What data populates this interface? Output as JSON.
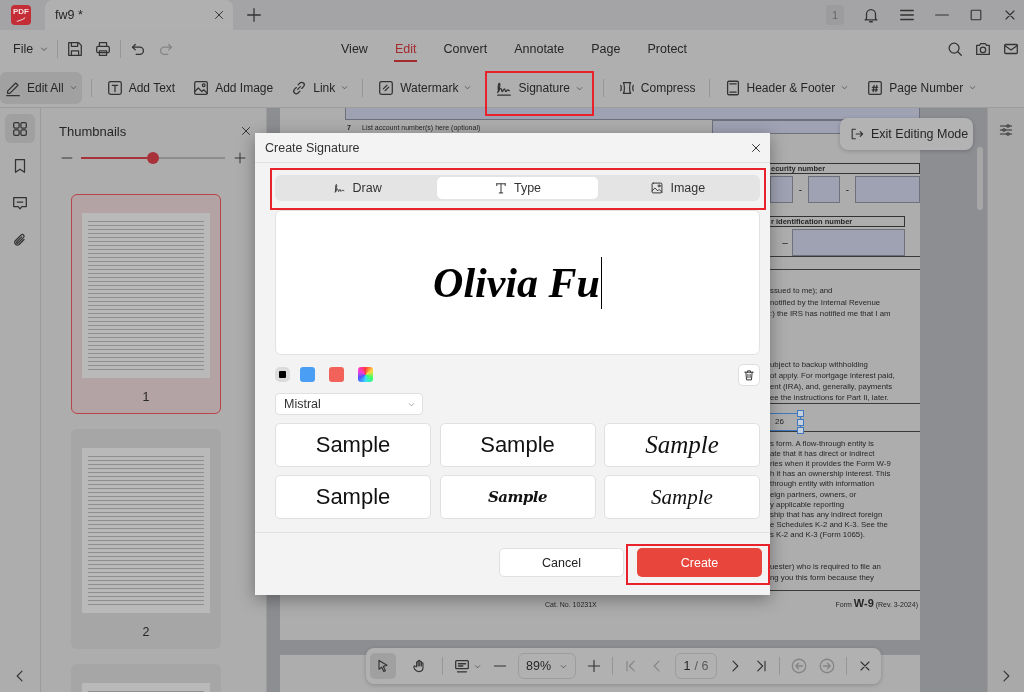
{
  "app": {
    "logo_text": "PDF"
  },
  "title_bar": {
    "tabs": [
      {
        "title": "fw9 *",
        "selected": true
      }
    ],
    "notification_count": "1"
  },
  "menu_bar": {
    "file_menu": "File",
    "quick_actions": [
      {
        "disabled": false
      },
      {
        "disabled": false
      },
      {
        "disabled": false
      },
      {
        "disabled": true
      }
    ],
    "ribbon_tabs": [
      {
        "label": "View",
        "selected": false
      },
      {
        "label": "Edit",
        "selected": true
      },
      {
        "label": "Convert",
        "selected": false
      },
      {
        "label": "Annotate",
        "selected": false
      },
      {
        "label": "Page",
        "selected": false
      },
      {
        "label": "Protect",
        "selected": false
      }
    ]
  },
  "toolbar": {
    "groups": [
      {
        "items": [
          {
            "label": "Edit All",
            "dropdown": true,
            "selected": true,
            "highlighted": false
          }
        ]
      },
      {
        "items": [
          {
            "label": "Add Text",
            "dropdown": false,
            "selected": false,
            "highlighted": false
          },
          {
            "label": "Add Image",
            "dropdown": false,
            "selected": false,
            "highlighted": false
          },
          {
            "label": "Link",
            "dropdown": true,
            "selected": false,
            "highlighted": false
          }
        ]
      },
      {
        "items": [
          {
            "label": "Watermark",
            "dropdown": true,
            "selected": false,
            "highlighted": false
          },
          {
            "label": "Signature",
            "dropdown": true,
            "selected": false,
            "highlighted": true
          }
        ]
      },
      {
        "items": [
          {
            "label": "Compress",
            "dropdown": false,
            "selected": false,
            "highlighted": false
          }
        ]
      },
      {
        "items": [
          {
            "label": "Header & Footer",
            "dropdown": true,
            "selected": false,
            "highlighted": false
          },
          {
            "label": "Page Number",
            "dropdown": true,
            "selected": false,
            "highlighted": false
          }
        ]
      }
    ]
  },
  "side_rail": {
    "items": [
      {
        "selected": true
      },
      {
        "selected": false
      },
      {
        "selected": false
      },
      {
        "selected": false
      }
    ]
  },
  "thumbnails": {
    "title": "Thumbnails",
    "zoom": {
      "level": 0.5
    },
    "pages": [
      {
        "label": "1",
        "selected": true
      },
      {
        "label": "2",
        "selected": false
      },
      {
        "selected": false
      }
    ]
  },
  "document": {
    "account_line": {
      "number": "7",
      "label": "List account number(s) here (optional)"
    },
    "ssn_label": "ecurity number",
    "ssn_dashes": [
      "-",
      "-"
    ],
    "ein_label": "r identification number",
    "ein_dashes": [
      "–"
    ],
    "cert_lines_1": [
      "ssued to me); and",
      "notified by the Internal Revenue",
      ":) the IRS has notified me that I am"
    ],
    "cert_lines_2": [
      "ubject to backup withholding",
      "ot apply. For mortgage interest paid,",
      "ent (IRA), and, generally, payments",
      "ee the instructions for Part II, later."
    ],
    "selected_text": "26",
    "paragraph_lines": [
      "s form. A flow-through entity is",
      "ate that it has direct or indirect",
      "ries when it provides the Form W-9",
      "h it has an ownership interest. This",
      "through entity with information",
      "eign partners, owners, or",
      "y applicable reporting",
      "ship that has any indirect foreign",
      "e Schedules K-2 and K-3. See the",
      "s K-2 and K-3 (Form 1065)."
    ],
    "requester_lines": [
      "uester) who is required to file an",
      "ng you this form because they"
    ],
    "catalog_number": "Cat. No. 10231X",
    "form_footer": "Form **W-9** (Rev. 3-2024)"
  },
  "exit_editing_button": {
    "label": "Exit Editing Mode"
  },
  "bottom_toolbar": {
    "tools": [
      {
        "selected": true
      },
      {
        "selected": false
      }
    ],
    "zoom_value": "89%",
    "page_nav": [
      {
        "disabled": true
      },
      {
        "disabled": true
      },
      {
        "disabled": false
      },
      {
        "disabled": false
      }
    ],
    "page_input": "1",
    "page_total": "/ 6",
    "history_nav": [
      {
        "disabled": true
      },
      {
        "disabled": true
      }
    ]
  },
  "dialog": {
    "title": "Create Signature",
    "tabs_highlighted": true,
    "tabs": [
      {
        "label": "Draw",
        "selected": false
      },
      {
        "label": "Type",
        "selected": true
      },
      {
        "label": "Image",
        "selected": false
      }
    ],
    "signature_input": {
      "value": "Olivia Fu"
    },
    "colors": [
      {
        "kind": "swatch",
        "color": "#000000",
        "selected": true
      },
      {
        "kind": "swatch",
        "color": "#4a9ff5",
        "selected": false
      },
      {
        "kind": "swatch",
        "color": "#f2625a",
        "selected": false
      },
      {
        "kind": "picker",
        "selected": false
      }
    ],
    "font_select": {
      "value": "Mistral"
    },
    "samples": [
      {
        "label": "Sample",
        "kind": "sans"
      },
      {
        "label": "Sample",
        "kind": "sans"
      },
      {
        "label": "Sample",
        "kind": "script"
      },
      {
        "label": "Sample",
        "kind": "sans"
      },
      {
        "label": "Sample",
        "kind": "brush"
      },
      {
        "label": "Sample",
        "kind": "calligraphy"
      }
    ],
    "buttons": [
      {
        "label": "Cancel",
        "kind": "secondary",
        "highlighted": false
      },
      {
        "label": "Create",
        "kind": "primary",
        "highlighted": true
      }
    ]
  }
}
